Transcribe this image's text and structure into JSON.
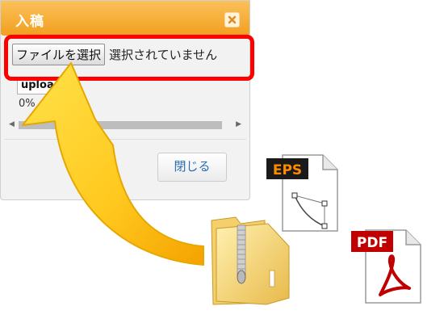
{
  "dialog": {
    "title": "入稿",
    "file_button_label": "ファイルを選択",
    "file_status": "選択されていません",
    "upload_button_label": "upload",
    "progress_text": "0%",
    "close_button_label": "閉じる"
  },
  "icons": {
    "eps_label": "EPS",
    "pdf_label": "PDF"
  },
  "colors": {
    "titlebar": "#f5a623",
    "highlight": "#ff0000",
    "arrow": "#ffc81e"
  }
}
